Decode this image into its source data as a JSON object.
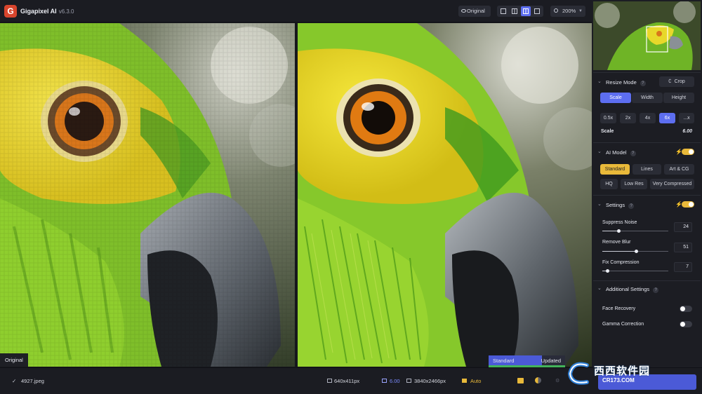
{
  "app": {
    "title": "Gigapixel AI",
    "version": "v6.3.0",
    "logo_letter": "G"
  },
  "toolbar": {
    "original_label": "Original",
    "zoom": "200%"
  },
  "panes": {
    "left_label": "Original"
  },
  "processing": {
    "label": "Standard",
    "status": "Updated",
    "progress": 0.7
  },
  "sidebar": {
    "resize_mode": {
      "title": "Resize Mode",
      "help": "?",
      "crop_label": "Crop",
      "modes": [
        "Scale",
        "Width",
        "Height"
      ],
      "active_mode": "Scale",
      "scale_options": [
        "0.5x",
        "2x",
        "4x",
        "6x",
        "...x"
      ],
      "active_scale": "6x",
      "scale_label": "Scale",
      "scale_value": "6.00"
    },
    "ai_model": {
      "title": "AI Model",
      "help": "?",
      "enabled": true,
      "row1": [
        "Standard",
        "Lines",
        "Art & CG"
      ],
      "row2": [
        "HQ",
        "Low Res",
        "Very Compressed"
      ],
      "active": "Standard"
    },
    "settings": {
      "title": "Settings",
      "help": "?",
      "enabled": true,
      "sliders": [
        {
          "label": "Suppress Noise",
          "value": "24",
          "fraction": 0.24
        },
        {
          "label": "Remove Blur",
          "value": "51",
          "fraction": 0.51
        },
        {
          "label": "Fix Compression",
          "value": "7",
          "fraction": 0.07
        }
      ]
    },
    "additional": {
      "title": "Additional Settings",
      "help": "?",
      "options": [
        {
          "label": "Face Recovery",
          "enabled": false
        },
        {
          "label": "Gamma Correction",
          "enabled": false
        }
      ]
    }
  },
  "bottom": {
    "file_name": "4927.jpeg",
    "input_size": "640x411px",
    "scale": "6.00",
    "output_size": "3840x2466px",
    "mode": "Auto"
  },
  "watermark": {
    "brand": "西西软件园",
    "domain": "CR173.COM"
  },
  "colors": {
    "accent": "#5d6ef0",
    "gold": "#e9b93a",
    "panel": "#1c1d23",
    "logo": "#d8452d"
  }
}
